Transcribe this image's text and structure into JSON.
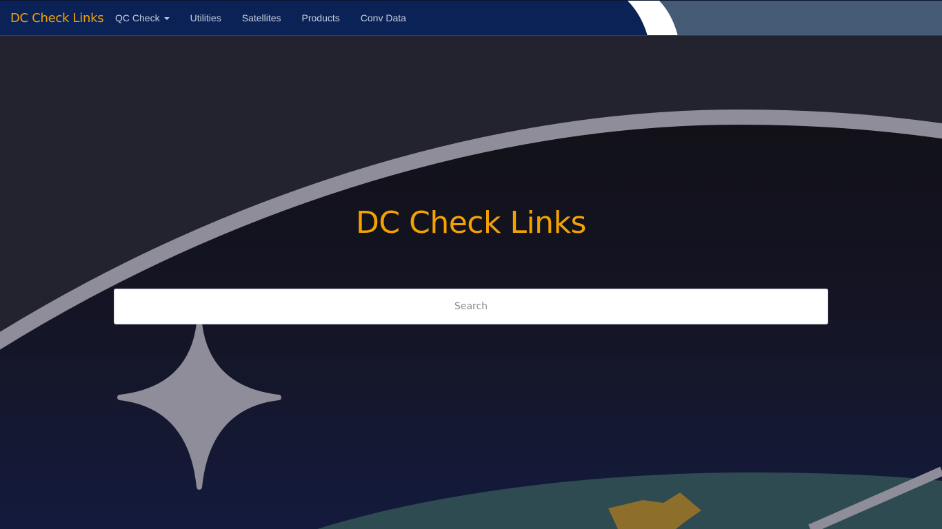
{
  "navbar": {
    "brand": "DC Check Links",
    "items": [
      {
        "label": "QC Check",
        "has_dropdown": true
      },
      {
        "label": "Utilities"
      },
      {
        "label": "Satellites"
      },
      {
        "label": "Products"
      },
      {
        "label": "Conv Data"
      }
    ]
  },
  "hero": {
    "title": "DC Check Links"
  },
  "search": {
    "placeholder": "Search",
    "value": ""
  },
  "colors": {
    "brand_accent": "#f5a200",
    "navbar_bg": "#0b2257",
    "page_bg": "#23222f",
    "orbit": "#8e8d99",
    "planet": "#2d4b50"
  }
}
